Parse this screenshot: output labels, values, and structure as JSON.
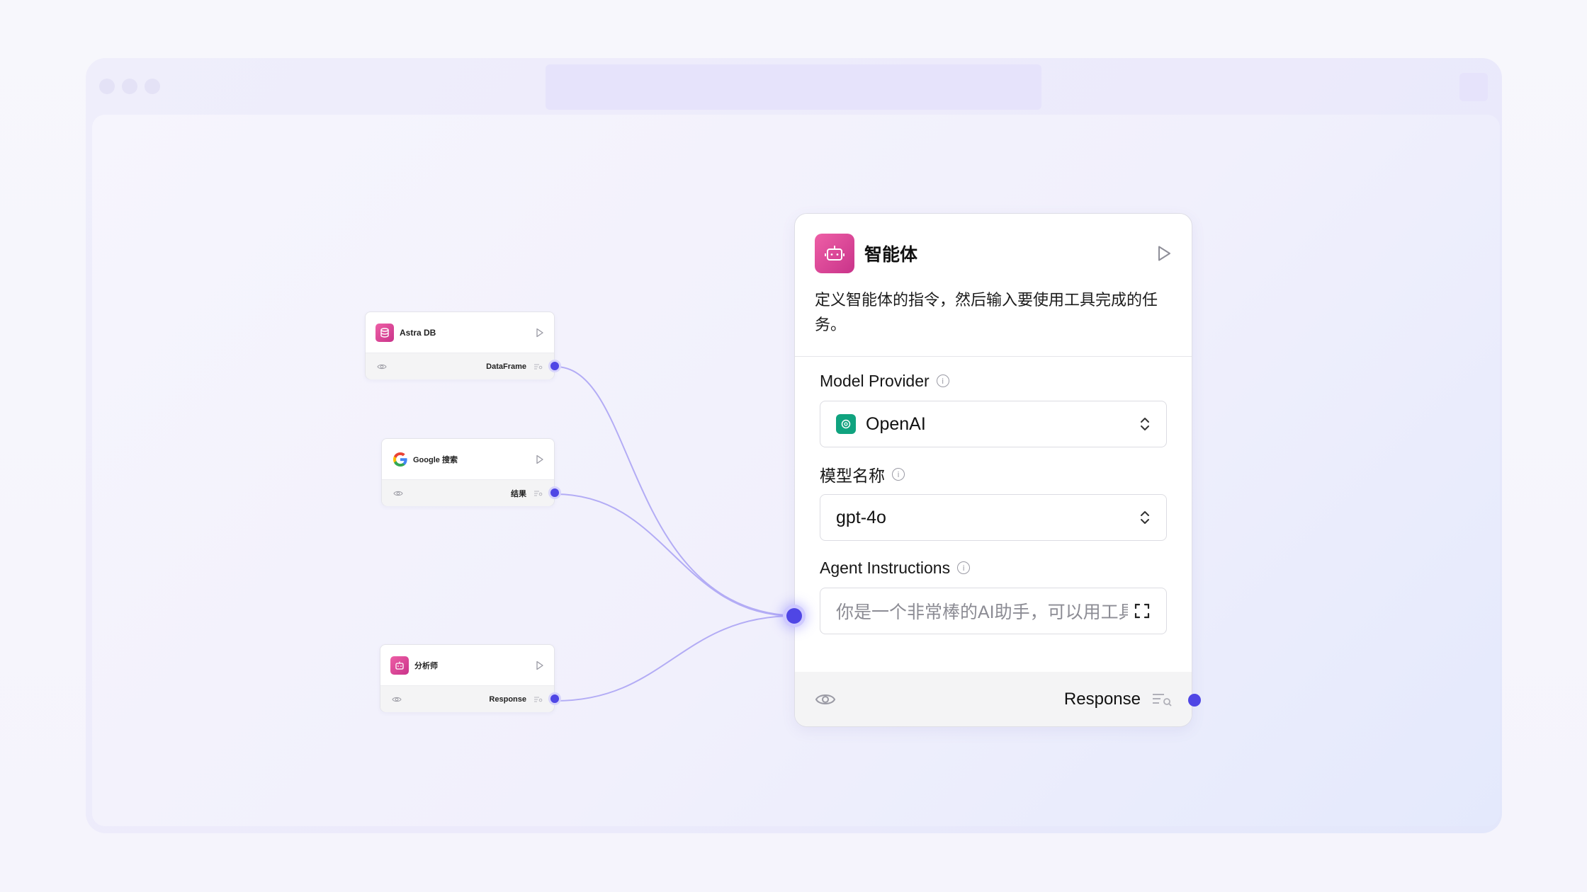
{
  "window": {
    "dots": 3
  },
  "nodes": [
    {
      "title": "Astra DB",
      "icon": "database-icon",
      "output": "DataFrame"
    },
    {
      "title": "Google 搜索",
      "icon": "google-icon",
      "output": "结果"
    },
    {
      "title": "分析师",
      "icon": "robot-icon",
      "output": "Response"
    }
  ],
  "agent": {
    "title": "智能体",
    "icon": "robot-icon",
    "description": "定义智能体的指令，然后输入要使用工具完成的任务。",
    "fields": {
      "model_provider": {
        "label": "Model Provider",
        "value": "OpenAI"
      },
      "model_name": {
        "label": "模型名称",
        "value": "gpt-4o"
      },
      "instructions": {
        "label": "Agent Instructions",
        "value": "你是一个非常棒的AI助手，可以用工具"
      }
    },
    "output": "Response"
  },
  "colors": {
    "accent": "#4f46e5",
    "node_icon": "#d9438f",
    "openai": "#10a37f",
    "edge": "#b3acf5"
  }
}
